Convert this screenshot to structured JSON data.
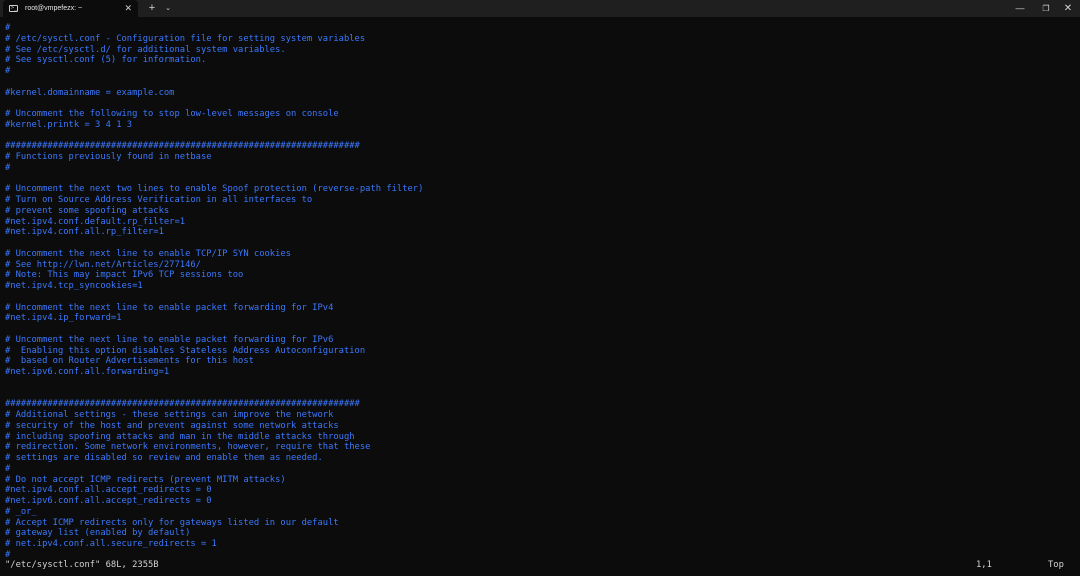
{
  "window": {
    "tab_title": "root@vmpefezx: ~",
    "tab_icon": "terminal-icon",
    "tab_close_glyph": "✕",
    "new_tab_glyph": "+",
    "dropdown_glyph": "⌄",
    "minimize_glyph": "—",
    "maximize_glyph": "❐",
    "close_glyph": "✕"
  },
  "colors": {
    "comment": "#3b78ff",
    "status_text": "#d4d4d4",
    "background": "#0c0c0c",
    "titlebar": "#1f1f1f"
  },
  "editor": {
    "lines": [
      "#",
      "# /etc/sysctl.conf - Configuration file for setting system variables",
      "# See /etc/sysctl.d/ for additional system variables.",
      "# See sysctl.conf (5) for information.",
      "#",
      "",
      "#kernel.domainname = example.com",
      "",
      "# Uncomment the following to stop low-level messages on console",
      "#kernel.printk = 3 4 1 3",
      "",
      "###################################################################",
      "# Functions previously found in netbase",
      "#",
      "",
      "# Uncomment the next two lines to enable Spoof protection (reverse-path filter)",
      "# Turn on Source Address Verification in all interfaces to",
      "# prevent some spoofing attacks",
      "#net.ipv4.conf.default.rp_filter=1",
      "#net.ipv4.conf.all.rp_filter=1",
      "",
      "# Uncomment the next line to enable TCP/IP SYN cookies",
      "# See http://lwn.net/Articles/277146/",
      "# Note: This may impact IPv6 TCP sessions too",
      "#net.ipv4.tcp_syncookies=1",
      "",
      "# Uncomment the next line to enable packet forwarding for IPv4",
      "#net.ipv4.ip_forward=1",
      "",
      "# Uncomment the next line to enable packet forwarding for IPv6",
      "#  Enabling this option disables Stateless Address Autoconfiguration",
      "#  based on Router Advertisements for this host",
      "#net.ipv6.conf.all.forwarding=1",
      "",
      "",
      "###################################################################",
      "# Additional settings - these settings can improve the network",
      "# security of the host and prevent against some network attacks",
      "# including spoofing attacks and man in the middle attacks through",
      "# redirection. Some network environments, however, require that these",
      "# settings are disabled so review and enable them as needed.",
      "#",
      "# Do not accept ICMP redirects (prevent MITM attacks)",
      "#net.ipv4.conf.all.accept_redirects = 0",
      "#net.ipv6.conf.all.accept_redirects = 0",
      "# _or_",
      "# Accept ICMP redirects only for gateways listed in our default",
      "# gateway list (enabled by default)",
      "# net.ipv4.conf.all.secure_redirects = 1",
      "#"
    ]
  },
  "status": {
    "file_info": "\"/etc/sysctl.conf\" 68L, 2355B",
    "cursor_pos": "1,1",
    "scroll_pos": "Top"
  }
}
